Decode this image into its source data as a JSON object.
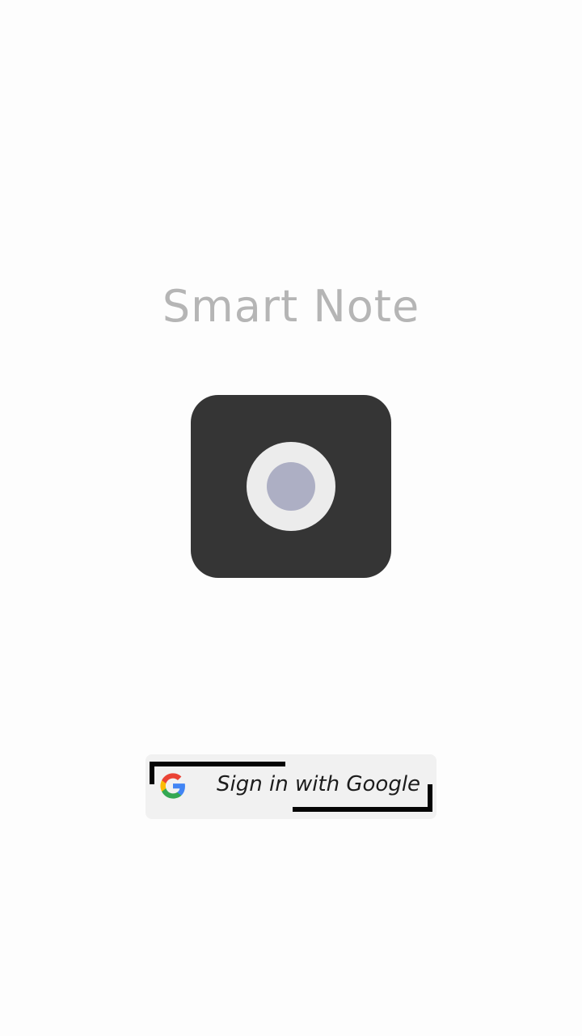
{
  "app": {
    "title": "Smart Note"
  },
  "logo": {
    "icon": "camera-record-icon",
    "colors": {
      "tile": "#353535",
      "ring": "#ececec",
      "dot": "#adafc4"
    }
  },
  "signin": {
    "label": "Sign in with Google",
    "icon": "google-icon"
  }
}
